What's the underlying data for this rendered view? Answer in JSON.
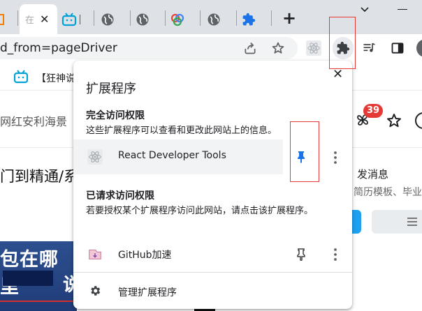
{
  "tabs": [
    {
      "label": "在",
      "close": "✕"
    }
  ],
  "toolbar": {
    "url_fragment": "d_from=pageDriver",
    "new_tab": "+"
  },
  "bookmarks": {
    "item_label": "【狂神说"
  },
  "page": {
    "search_text": "网红安利海景",
    "heading": "门到精通/系",
    "notification_label": "发消息",
    "resume_text": "简历模板、毕业",
    "badge_count": "39",
    "banner_text": "包在哪里",
    "banner_text2": "说"
  },
  "popup": {
    "title": "扩展程序",
    "close": "✕",
    "full_access": {
      "title": "完全访问权限",
      "desc": "这些扩展程序可以查看和更改此网站上的信息。",
      "extensions": [
        {
          "name": "React Developer Tools",
          "pinned": true
        }
      ]
    },
    "requested_access": {
      "title": "已请求访问权限",
      "desc": "若要授权某个扩展程序访问此网站，请点击该扩展程序。",
      "extensions": [
        {
          "name": "GitHub加速",
          "pinned": false
        }
      ]
    },
    "manage_label": "管理扩展程序"
  },
  "colors": {
    "pin_active": "#1a73e8",
    "highlight": "#e53935",
    "badge": "#e53935"
  }
}
